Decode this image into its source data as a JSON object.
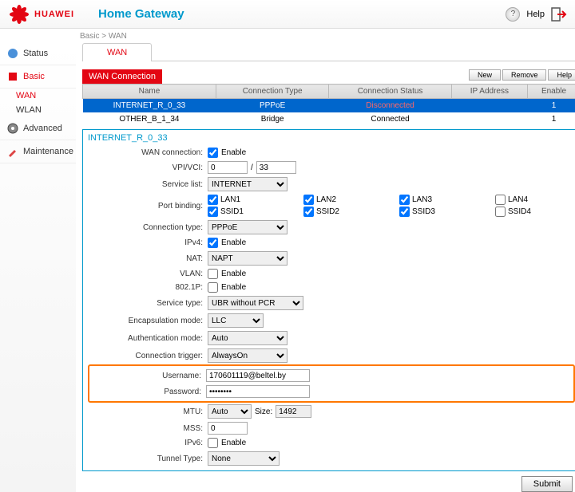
{
  "header": {
    "brand": "HUAWEI",
    "title": "Home Gateway",
    "help": "Help"
  },
  "breadcrumb": "Basic > WAN",
  "sidebar": {
    "items": [
      {
        "label": "Status"
      },
      {
        "label": "Basic"
      },
      {
        "label": "Advanced"
      },
      {
        "label": "Maintenance"
      }
    ],
    "sub": [
      {
        "label": "WAN"
      },
      {
        "label": "WLAN"
      }
    ]
  },
  "tab": "WAN",
  "section": "WAN Connection",
  "buttons": {
    "new": "New",
    "remove": "Remove",
    "help": "Help",
    "submit": "Submit"
  },
  "table": {
    "headers": {
      "name": "Name",
      "type": "Connection Type",
      "status": "Connection Status",
      "ip": "IP Address",
      "enable": "Enable"
    },
    "rows": [
      {
        "name": "INTERNET_R_0_33",
        "type": "PPPoE",
        "status": "Disconnected",
        "ip": "",
        "enable": "1"
      },
      {
        "name": "OTHER_B_1_34",
        "type": "Bridge",
        "status": "Connected",
        "ip": "",
        "enable": "1"
      }
    ]
  },
  "panel": {
    "title": "INTERNET_R_0_33",
    "labels": {
      "wan_conn": "WAN connection:",
      "enable": "Enable",
      "vpivci": "VPI/VCI:",
      "vpi": "0",
      "vci": "33",
      "service_list": "Service list:",
      "service_list_val": "INTERNET",
      "port_binding": "Port binding:",
      "conn_type": "Connection type:",
      "conn_type_val": "PPPoE",
      "ipv4": "IPv4:",
      "nat": "NAT:",
      "nat_val": "NAPT",
      "vlan": "VLAN:",
      "dot1p": "802.1P:",
      "service_type": "Service type:",
      "service_type_val": "UBR without PCR",
      "encap": "Encapsulation mode:",
      "encap_val": "LLC",
      "auth": "Authentication mode:",
      "auth_val": "Auto",
      "trigger": "Connection trigger:",
      "trigger_val": "AlwaysOn",
      "username": "Username:",
      "username_val": "170601119@beltel.by",
      "password": "Password:",
      "password_val": "********",
      "mtu": "MTU:",
      "mtu_mode": "Auto",
      "size_lbl": "Size:",
      "mtu_size": "1492",
      "mss": "MSS:",
      "mss_val": "0",
      "ipv6": "IPv6:",
      "tunnel": "Tunnel Type:",
      "tunnel_val": "None"
    },
    "ports": {
      "lan1": "LAN1",
      "lan2": "LAN2",
      "lan3": "LAN3",
      "lan4": "LAN4",
      "ssid1": "SSID1",
      "ssid2": "SSID2",
      "ssid3": "SSID3",
      "ssid4": "SSID4"
    }
  }
}
